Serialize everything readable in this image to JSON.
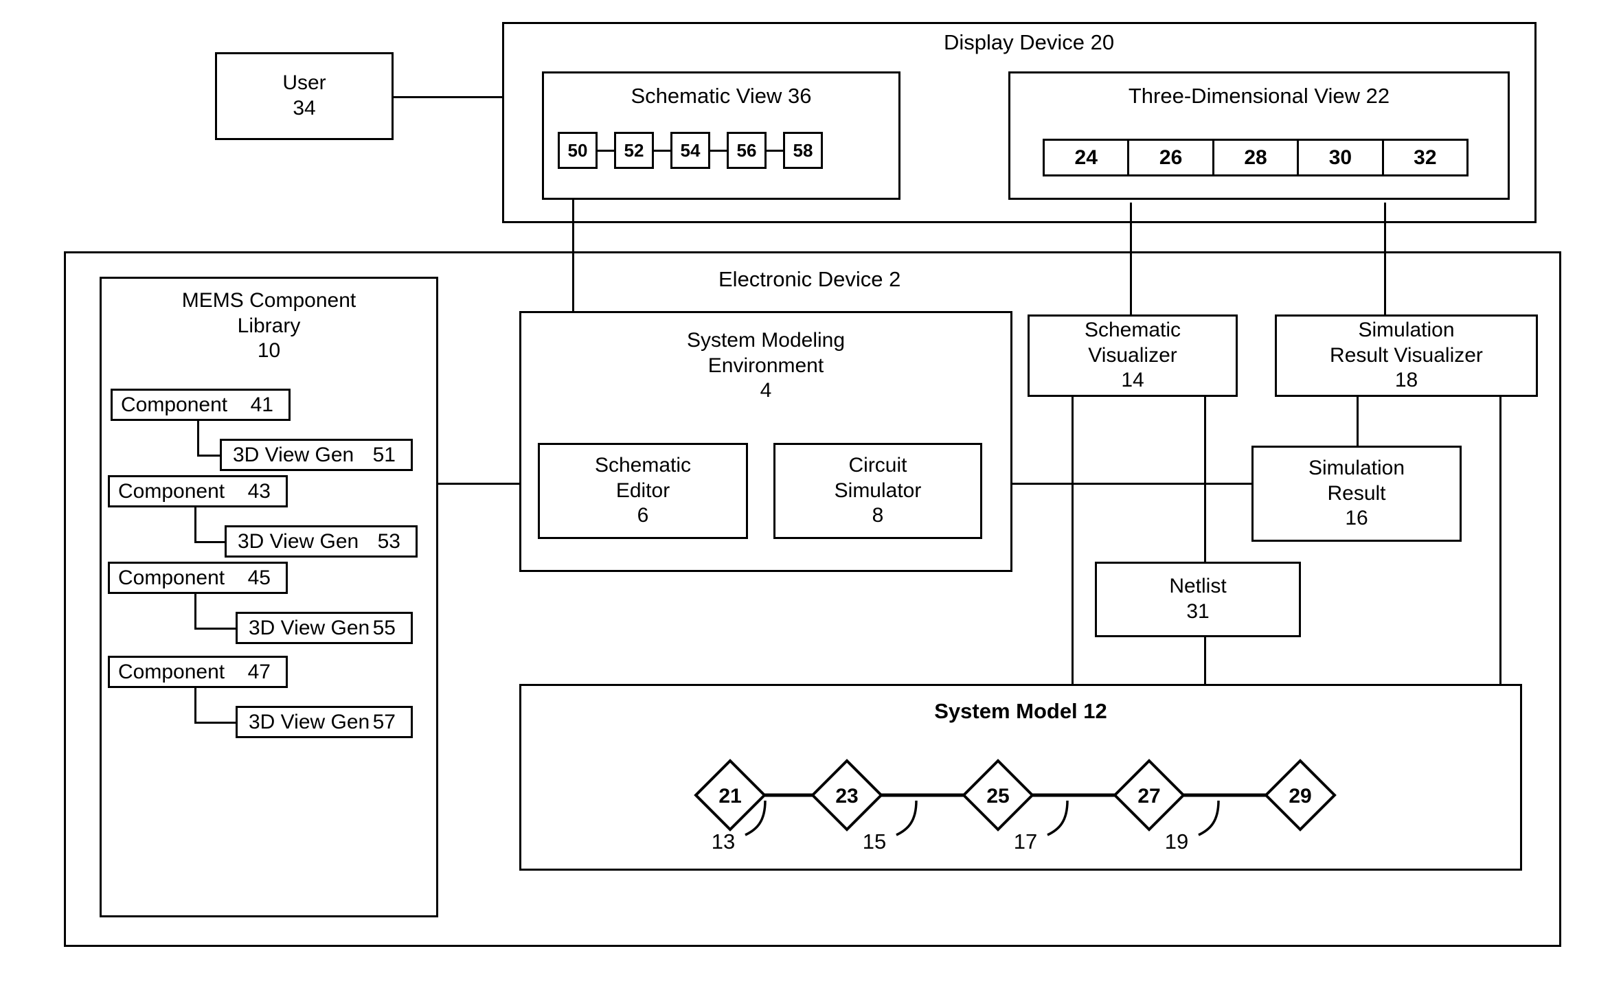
{
  "figure": {
    "type": "patent-block-diagram",
    "background": "#ffffff",
    "stroke": "#000000"
  },
  "user_block": {
    "line1": "User",
    "line2": "34"
  },
  "display_device": {
    "title": "Display Device 20",
    "schematic_view": {
      "title": "Schematic View 36",
      "chips": [
        "50",
        "52",
        "54",
        "56",
        "58"
      ]
    },
    "three_d_view": {
      "title": "Three-Dimensional View 22",
      "cells": [
        "24",
        "26",
        "28",
        "30",
        "32"
      ]
    }
  },
  "electronic_device": {
    "title": "Electronic Device 2",
    "mems_library": {
      "line1": "MEMS Component",
      "line2": "Library",
      "line3": "10",
      "components": [
        {
          "label": "Component",
          "num": "41",
          "gen_label": "3D View Gen",
          "gen_num": "51"
        },
        {
          "label": "Component",
          "num": "43",
          "gen_label": "3D View Gen",
          "gen_num": "53"
        },
        {
          "label": "Component",
          "num": "45",
          "gen_label": "3D View Gen",
          "gen_num": "55"
        },
        {
          "label": "Component",
          "num": "47",
          "gen_label": "3D View Gen",
          "gen_num": "57"
        }
      ]
    },
    "system_modeling_environment": {
      "line1": "System Modeling",
      "line2": "Environment",
      "line3": "4",
      "schematic_editor": {
        "line1": "Schematic",
        "line2": "Editor",
        "line3": "6"
      },
      "circuit_simulator": {
        "line1": "Circuit",
        "line2": "Simulator",
        "line3": "8"
      }
    },
    "schematic_visualizer": {
      "line1": "Schematic",
      "line2": "Visualizer",
      "line3": "14"
    },
    "simulation_result_visualizer": {
      "line1": "Simulation",
      "line2": "Result Visualizer",
      "line3": "18"
    },
    "simulation_result": {
      "line1": "Simulation",
      "line2": "Result",
      "line3": "16"
    },
    "netlist": {
      "line1": "Netlist",
      "line2": "31"
    },
    "system_model": {
      "title": "System Model 12",
      "nodes": [
        "21",
        "23",
        "25",
        "27",
        "29"
      ],
      "link_labels": [
        "13",
        "15",
        "17",
        "19"
      ]
    }
  }
}
